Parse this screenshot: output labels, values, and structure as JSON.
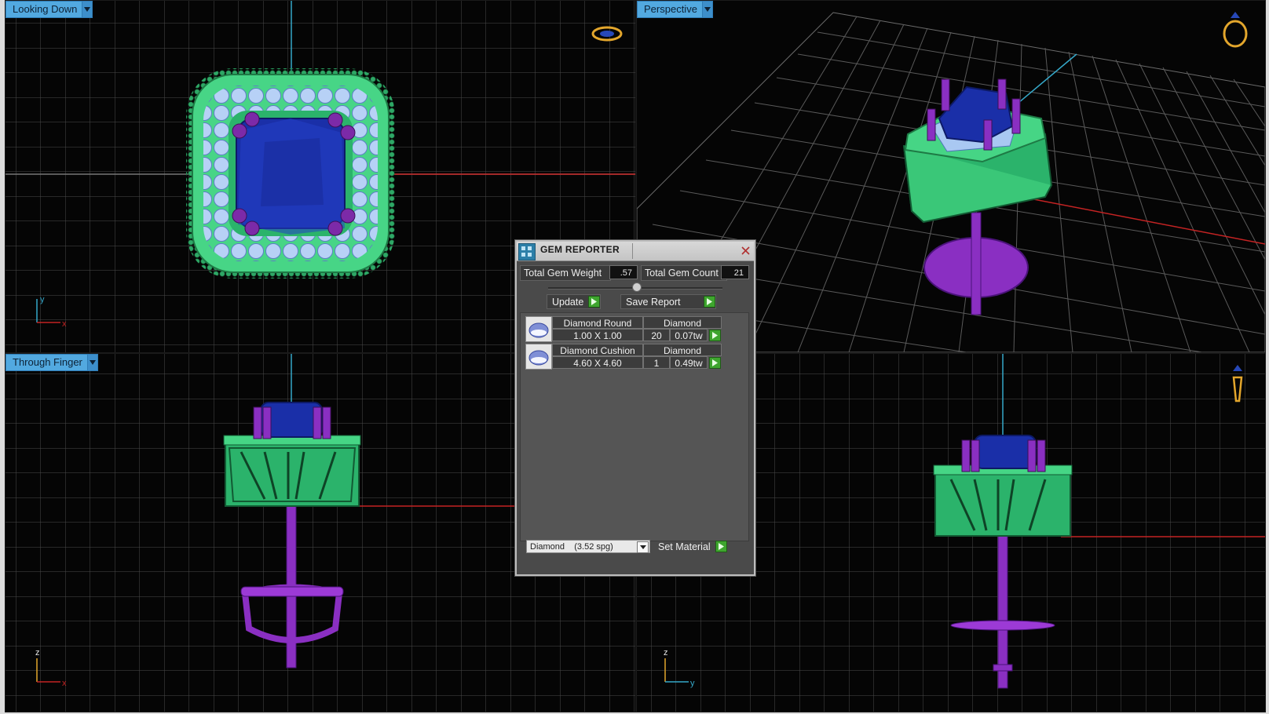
{
  "viewports": {
    "top_left": {
      "label": "Looking Down",
      "axis1": "y",
      "axis2": "x"
    },
    "top_right": {
      "label": "Perspective"
    },
    "bottom_left": {
      "label": "Through Finger",
      "axis1": "z",
      "axis2": "x"
    },
    "bottom_right": {
      "label": "",
      "axis1": "z",
      "axis2": "y"
    }
  },
  "gem_reporter": {
    "title": "GEM REPORTER",
    "total_weight_label": "Total Gem Weight",
    "total_weight_value": ".57",
    "total_count_label": "Total Gem Count",
    "total_count_value": "21",
    "update_label": "Update",
    "save_report_label": "Save Report",
    "gems": [
      {
        "shape": "Diamond Round",
        "material": "Diamond",
        "size": "1.00 X 1.00",
        "count": "20",
        "weight": "0.07tw"
      },
      {
        "shape": "Diamond Cushion",
        "material": "Diamond",
        "size": "4.60 X 4.60",
        "count": "1",
        "weight": "0.49tw"
      }
    ],
    "material_select": "Diamond    (3.52 spg)",
    "set_material_label": "Set Material"
  },
  "colors": {
    "viewport_bg": "#050505",
    "grid": "#4c4c4c",
    "label_bg": "#52a9e0",
    "setting_green": "#3ecb78",
    "gem_blue": "#1a2fa8",
    "metal_purple": "#8a2fc2",
    "halo_blue": "#a9c8f2",
    "go_green": "#3ea52e"
  },
  "icons": {
    "navigator_ring_top": "ring-top-icon",
    "navigator_ring_perspective": "ring-perspective-icon",
    "navigator_ring_side": "ring-side-icon"
  }
}
